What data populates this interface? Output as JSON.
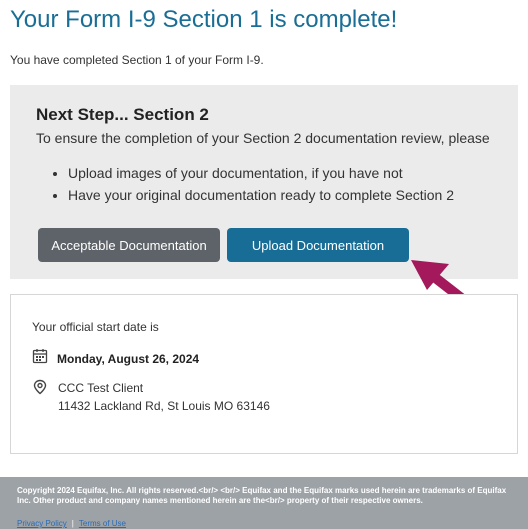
{
  "page": {
    "title": "Your Form I-9 Section 1 is complete!",
    "intro": "You have completed Section 1 of your Form I-9."
  },
  "next_step": {
    "heading": "Next Step... Section 2",
    "description": "To ensure the completion of your Section 2 documentation review, please",
    "bullets": [
      "Upload images of your documentation, if you have not",
      "Have your original documentation ready to complete Section 2"
    ],
    "buttons": {
      "acceptable": "Acceptable Documentation",
      "upload": "Upload Documentation"
    }
  },
  "start": {
    "label": "Your official start date is",
    "date": "Monday, August 26, 2024",
    "location_name": "CCC Test Client",
    "location_address": "11432 Lackland Rd, St Louis MO 63146"
  },
  "footer": {
    "copyright": "Copyright 2024 Equifax, Inc. All rights reserved.<br/> <br/> Equifax and the Equifax marks used herein are trademarks of Equifax Inc. Other product and company names mentioned herein are the<br/> property of their respective owners.",
    "privacy": "Privacy Policy",
    "separator": "|",
    "terms": "Terms of Use"
  },
  "colors": {
    "title": "#1a6e96",
    "upload_button": "#176d95",
    "acceptable_button": "#5d6368",
    "arrow": "#a3195b",
    "footer_bg": "#9da2a7"
  },
  "icons": {
    "date": "calendar-icon",
    "location": "location-pin-icon",
    "pointer": "arrow-icon"
  }
}
